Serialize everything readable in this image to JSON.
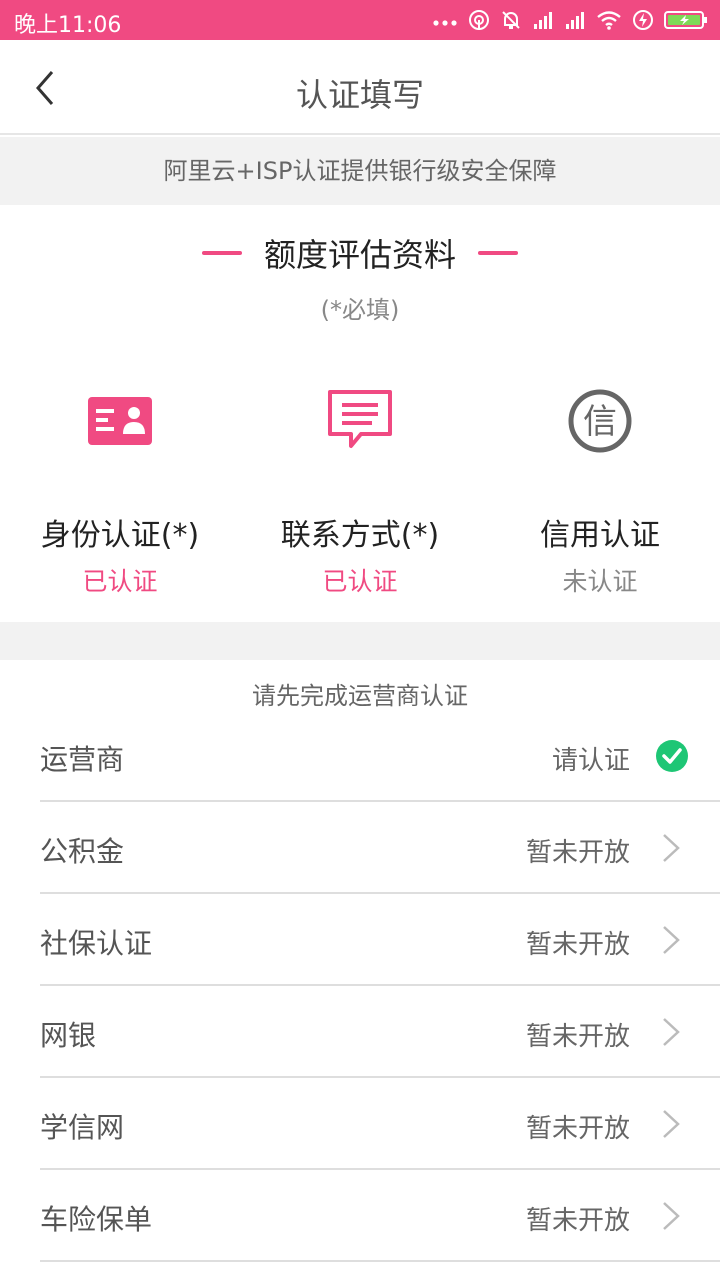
{
  "status_bar": {
    "time": "晚上11:06",
    "icons": [
      "more-dots-icon",
      "hotspot-icon",
      "alarm-off-icon",
      "signal-icon",
      "signal-icon",
      "wifi-icon",
      "power-icon",
      "battery-icon"
    ]
  },
  "header": {
    "title": "认证填写",
    "back_icon": "chevron-left-icon"
  },
  "banner": {
    "text": "阿里云+ISP认证提供银行级安全保障"
  },
  "section": {
    "title": "额度评估资料",
    "note": "(*必填)"
  },
  "certifications": [
    {
      "label": "身份认证(*)",
      "status": "已认证",
      "icon": "id-card-icon"
    },
    {
      "label": "联系方式(*)",
      "status": "已认证",
      "icon": "message-icon"
    },
    {
      "label": "信用认证",
      "status": "未认证",
      "icon": "credit-icon",
      "icon_text": "信"
    }
  ],
  "colors": {
    "accent": "#f04a82",
    "success": "#1ec675"
  },
  "notice": "请先完成运营商认证",
  "list": [
    {
      "label": "运营商",
      "value": "请认证",
      "icon": "check-circle-icon"
    },
    {
      "label": "公积金",
      "value": "暂未开放",
      "icon": "chevron-right-icon"
    },
    {
      "label": "社保认证",
      "value": "暂未开放",
      "icon": "chevron-right-icon"
    },
    {
      "label": "网银",
      "value": "暂未开放",
      "icon": "chevron-right-icon"
    },
    {
      "label": "学信网",
      "value": "暂未开放",
      "icon": "chevron-right-icon"
    },
    {
      "label": "车险保单",
      "value": "暂未开放",
      "icon": "chevron-right-icon"
    }
  ]
}
